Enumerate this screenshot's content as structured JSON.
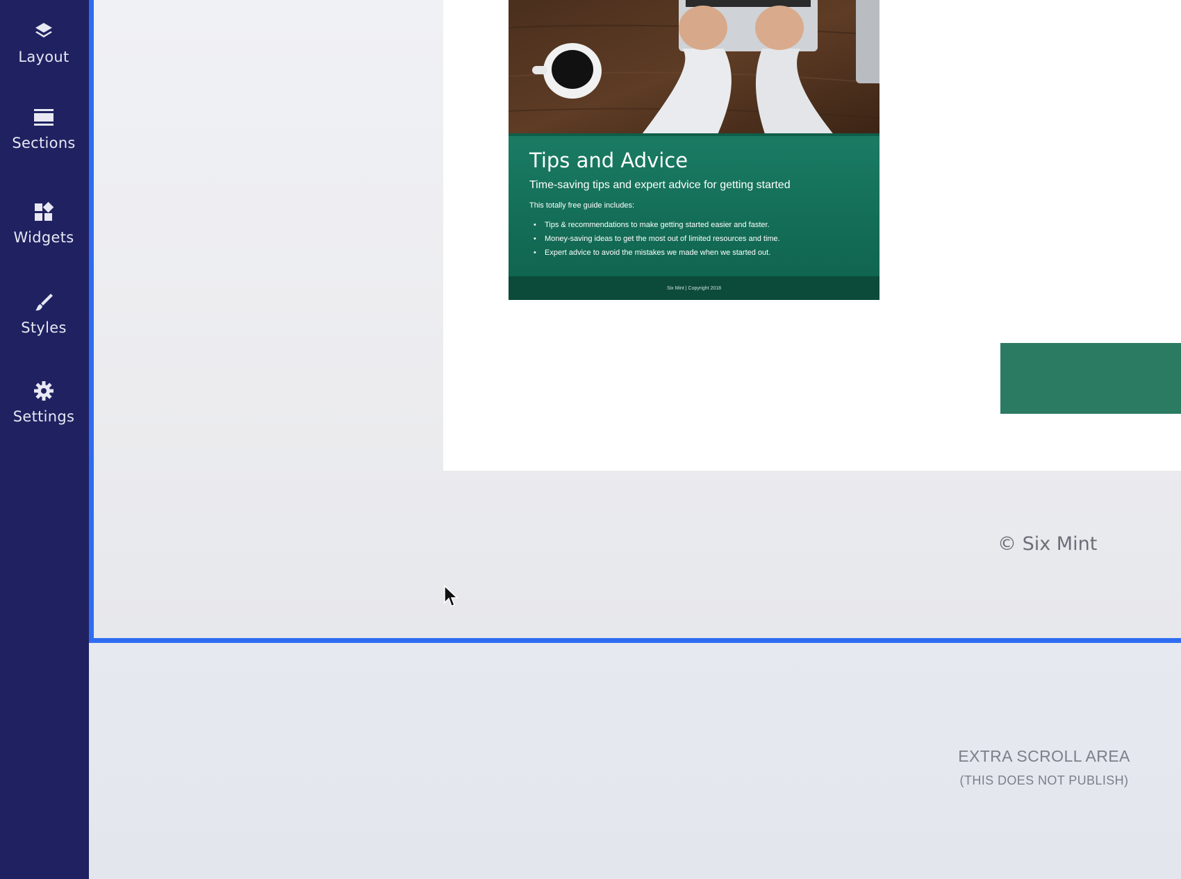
{
  "sidebar": {
    "items": [
      {
        "label": "Layout",
        "icon": "layers-icon"
      },
      {
        "label": "Sections",
        "icon": "sections-icon"
      },
      {
        "label": "Widgets",
        "icon": "widgets-icon"
      },
      {
        "label": "Styles",
        "icon": "brush-icon"
      },
      {
        "label": "Settings",
        "icon": "gear-icon"
      }
    ]
  },
  "guide": {
    "title": "Tips and Advice",
    "subtitle": "Time-saving tips and expert advice for getting started",
    "includes": "This totally free guide includes:",
    "bullets": [
      "Tips & recommendations to make getting started easier and faster.",
      "Money-saving ideas to get the most out of limited resources and time.",
      "Expert advice to avoid the mistakes we made when we started out."
    ],
    "footer": "Six Mint | Copyright 2018"
  },
  "footer": {
    "copyright": "© Six Mint"
  },
  "extra_scroll": {
    "title": "EXTRA SCROLL AREA",
    "subtitle": "(THIS DOES NOT PUBLISH)"
  },
  "colors": {
    "sidebar": "#1f2160",
    "selection_border": "#2f6df0",
    "guide_green": "#1a7b63",
    "button_green": "#2b7a62"
  }
}
